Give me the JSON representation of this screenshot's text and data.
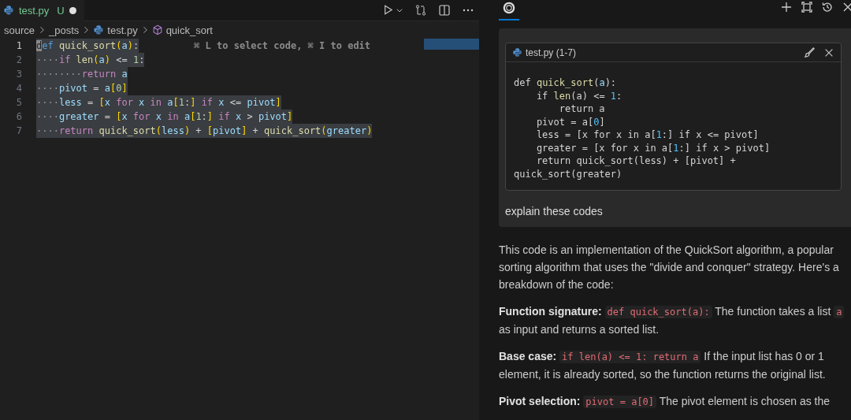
{
  "editor": {
    "tab": {
      "filename": "test.py",
      "status": "U",
      "modified": true,
      "selected": true
    },
    "breadcrumbs": [
      {
        "label": "source",
        "kind": "folder"
      },
      {
        "label": "_posts",
        "kind": "folder"
      },
      {
        "label": "test.py",
        "kind": "file"
      },
      {
        "label": "quick_sort",
        "kind": "symbol"
      }
    ],
    "hint": "⌘ L to select code, ⌘ I to edit",
    "lines": [
      {
        "number": "1",
        "current": true,
        "selected": true,
        "tokens": [
          {
            "kind": "kw",
            "text": "def "
          },
          {
            "kind": "fn",
            "text": "quick_sort"
          },
          {
            "kind": "br",
            "text": "("
          },
          {
            "kind": "var",
            "text": "a"
          },
          {
            "kind": "br",
            "text": ")"
          },
          {
            "kind": "plain",
            "text": ":"
          }
        ]
      },
      {
        "number": "2",
        "current": false,
        "selected": true,
        "tokens": [
          {
            "kind": "ws",
            "text": "····"
          },
          {
            "kind": "ctl",
            "text": "if "
          },
          {
            "kind": "fn",
            "text": "len"
          },
          {
            "kind": "br",
            "text": "("
          },
          {
            "kind": "var",
            "text": "a"
          },
          {
            "kind": "br",
            "text": ")"
          },
          {
            "kind": "plain",
            "text": " <= "
          },
          {
            "kind": "num",
            "text": "1"
          },
          {
            "kind": "plain",
            "text": ":"
          }
        ]
      },
      {
        "number": "3",
        "current": false,
        "selected": true,
        "tokens": [
          {
            "kind": "ws",
            "text": "········"
          },
          {
            "kind": "ctl",
            "text": "return "
          },
          {
            "kind": "var",
            "text": "a"
          }
        ]
      },
      {
        "number": "4",
        "current": false,
        "selected": true,
        "tokens": [
          {
            "kind": "ws",
            "text": "····"
          },
          {
            "kind": "var",
            "text": "pivot"
          },
          {
            "kind": "plain",
            "text": " = "
          },
          {
            "kind": "var",
            "text": "a"
          },
          {
            "kind": "br",
            "text": "["
          },
          {
            "kind": "num",
            "text": "0"
          },
          {
            "kind": "br",
            "text": "]"
          }
        ]
      },
      {
        "number": "5",
        "current": false,
        "selected": true,
        "tokens": [
          {
            "kind": "ws",
            "text": "····"
          },
          {
            "kind": "var",
            "text": "less"
          },
          {
            "kind": "plain",
            "text": " = "
          },
          {
            "kind": "br",
            "text": "["
          },
          {
            "kind": "var",
            "text": "x "
          },
          {
            "kind": "ctl",
            "text": "for "
          },
          {
            "kind": "var",
            "text": "x "
          },
          {
            "kind": "ctl",
            "text": "in "
          },
          {
            "kind": "var",
            "text": "a"
          },
          {
            "kind": "br",
            "text": "["
          },
          {
            "kind": "num",
            "text": "1"
          },
          {
            "kind": "plain",
            "text": ":"
          },
          {
            "kind": "br",
            "text": "] "
          },
          {
            "kind": "ctl",
            "text": "if "
          },
          {
            "kind": "var",
            "text": "x"
          },
          {
            "kind": "plain",
            "text": " <= "
          },
          {
            "kind": "var",
            "text": "pivot"
          },
          {
            "kind": "br",
            "text": "]"
          }
        ]
      },
      {
        "number": "6",
        "current": false,
        "selected": true,
        "tokens": [
          {
            "kind": "ws",
            "text": "····"
          },
          {
            "kind": "var",
            "text": "greater"
          },
          {
            "kind": "plain",
            "text": " = "
          },
          {
            "kind": "br",
            "text": "["
          },
          {
            "kind": "var",
            "text": "x "
          },
          {
            "kind": "ctl",
            "text": "for "
          },
          {
            "kind": "var",
            "text": "x "
          },
          {
            "kind": "ctl",
            "text": "in "
          },
          {
            "kind": "var",
            "text": "a"
          },
          {
            "kind": "br",
            "text": "["
          },
          {
            "kind": "num",
            "text": "1"
          },
          {
            "kind": "plain",
            "text": ":"
          },
          {
            "kind": "br",
            "text": "] "
          },
          {
            "kind": "ctl",
            "text": "if "
          },
          {
            "kind": "var",
            "text": "x"
          },
          {
            "kind": "plain",
            "text": " > "
          },
          {
            "kind": "var",
            "text": "pivot"
          },
          {
            "kind": "br",
            "text": "]"
          }
        ]
      },
      {
        "number": "7",
        "current": false,
        "selected": true,
        "tokens": [
          {
            "kind": "ws",
            "text": "····"
          },
          {
            "kind": "ctl",
            "text": "return "
          },
          {
            "kind": "fn",
            "text": "quick_sort"
          },
          {
            "kind": "br",
            "text": "("
          },
          {
            "kind": "var",
            "text": "less"
          },
          {
            "kind": "br",
            "text": ")"
          },
          {
            "kind": "plain",
            "text": " + "
          },
          {
            "kind": "br",
            "text": "["
          },
          {
            "kind": "var",
            "text": "pivot"
          },
          {
            "kind": "br",
            "text": "]"
          },
          {
            "kind": "plain",
            "text": " + "
          },
          {
            "kind": "fn",
            "text": "quick_sort"
          },
          {
            "kind": "br",
            "text": "("
          },
          {
            "kind": "var",
            "text": "greater"
          },
          {
            "kind": "br",
            "text": ")"
          }
        ]
      }
    ]
  },
  "chat": {
    "tab": {
      "selected": true
    },
    "context": {
      "title": "test.py (1-7)",
      "lines": [
        [
          {
            "kind": "plain",
            "text": "def "
          },
          {
            "kind": "fn",
            "text": "quick_sort"
          },
          {
            "kind": "plain",
            "text": "("
          },
          {
            "kind": "var",
            "text": "a"
          },
          {
            "kind": "plain",
            "text": "):"
          }
        ],
        [
          {
            "kind": "plain",
            "text": "    if "
          },
          {
            "kind": "fn",
            "text": "len"
          },
          {
            "kind": "plain",
            "text": "(a) <= "
          },
          {
            "kind": "num",
            "text": "1"
          },
          {
            "kind": "plain",
            "text": ":"
          }
        ],
        [
          {
            "kind": "plain",
            "text": "        return a"
          }
        ],
        [
          {
            "kind": "plain",
            "text": "    pivot = a["
          },
          {
            "kind": "num",
            "text": "0"
          },
          {
            "kind": "plain",
            "text": "]"
          }
        ],
        [
          {
            "kind": "plain",
            "text": "    less = [x for x in a["
          },
          {
            "kind": "num",
            "text": "1"
          },
          {
            "kind": "plain",
            "text": ":] if x <= pivot]"
          }
        ],
        [
          {
            "kind": "plain",
            "text": "    greater = [x for x in a["
          },
          {
            "kind": "num",
            "text": "1"
          },
          {
            "kind": "plain",
            "text": ":] if x > pivot]"
          }
        ],
        [
          {
            "kind": "plain",
            "text": "    return quick_sort(less) + [pivot] +"
          }
        ],
        [
          {
            "kind": "plain",
            "text": "quick_sort(greater)"
          }
        ]
      ]
    },
    "prompt": "explain these codes",
    "answer": [
      [
        {
          "kind": "text",
          "text": "This code is an implementation of the QuickSort algorithm, a popular sorting algorithm that uses the \"divide and conquer\" strategy. Here's a breakdown of the code:"
        }
      ],
      [
        {
          "kind": "bold",
          "text": "Function signature: "
        },
        {
          "kind": "code",
          "text": "def quick_sort(a):"
        },
        {
          "kind": "text",
          "text": " The function takes a list "
        },
        {
          "kind": "code",
          "text": "a"
        },
        {
          "kind": "text",
          "text": " as input and returns a sorted list."
        }
      ],
      [
        {
          "kind": "bold",
          "text": "Base case: "
        },
        {
          "kind": "code",
          "text": "if len(a) <= 1: return a"
        },
        {
          "kind": "text",
          "text": " If the input list has 0 or 1 element, it is already sorted, so the function returns the original list."
        }
      ],
      [
        {
          "kind": "bold",
          "text": "Pivot selection: "
        },
        {
          "kind": "code",
          "text": "pivot = a[0]"
        },
        {
          "kind": "text",
          "text": " The pivot element is chosen as the"
        }
      ]
    ]
  }
}
